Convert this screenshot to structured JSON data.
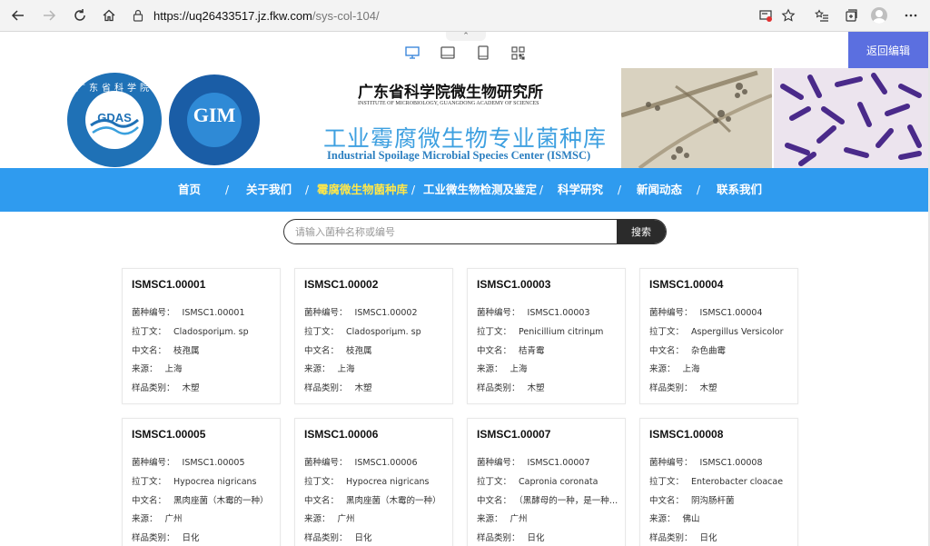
{
  "browser": {
    "url_host": "https://uq26433517.jz.fkw.com",
    "url_path": "/sys-col-104/"
  },
  "editor": {
    "back_edit": "返回编辑",
    "collapse_glyph": "⌃"
  },
  "header": {
    "institute_cn": "广东省科学院微生物研究所",
    "institute_en": "INSTITUTE OF MICROBIOLOGY, GUANGDONG ACADEMY OF SCIENCES",
    "site_cn": "工业霉腐微生物专业菌种库",
    "site_en": "Industrial Spoilage Microbial Species Center (ISMSC)",
    "logo1_text": "GDAS",
    "logo1_ring": "广东省科学院",
    "logo2_text": "GIM"
  },
  "nav": [
    {
      "label": "首页",
      "active": false
    },
    {
      "label": "关于我们",
      "active": false
    },
    {
      "label": "霉腐微生物菌种库",
      "active": true
    },
    {
      "label": "工业微生物检测及鉴定",
      "active": false
    },
    {
      "label": "科学研究",
      "active": false
    },
    {
      "label": "新闻动态",
      "active": false
    },
    {
      "label": "联系我们",
      "active": false
    }
  ],
  "nav_separator": "/",
  "search": {
    "placeholder": "请输入菌种名称或编号",
    "button": "搜索"
  },
  "labels": {
    "code": "菌种编号：",
    "latin": "拉丁文：",
    "cn": "中文名：",
    "source": "来源：",
    "category": "样品类别："
  },
  "strains": [
    {
      "title": "ISMSC1.00001",
      "code": "ISMSC1.00001",
      "latin": "Cladosporiμm. sp",
      "cn": "枝孢属",
      "source": "上海",
      "category": "木塑"
    },
    {
      "title": "ISMSC1.00002",
      "code": "ISMSC1.00002",
      "latin": "Cladosporiμm. sp",
      "cn": "枝孢属",
      "source": "上海",
      "category": "木塑"
    },
    {
      "title": "ISMSC1.00003",
      "code": "ISMSC1.00003",
      "latin": "Penicillium citrinμm",
      "cn": "桔青霉",
      "source": "上海",
      "category": "木塑"
    },
    {
      "title": "ISMSC1.00004",
      "code": "ISMSC1.00004",
      "latin": "Aspergillus Versicolor",
      "cn": "杂色曲霉",
      "source": "上海",
      "category": "木塑"
    },
    {
      "title": "ISMSC1.00005",
      "code": "ISMSC1.00005",
      "latin": "Hypocrea nigricans",
      "cn": "黑肉座菌（木霉的一种）",
      "source": "广州",
      "category": "日化"
    },
    {
      "title": "ISMSC1.00006",
      "code": "ISMSC1.00006",
      "latin": "Hypocrea nigricans",
      "cn": "黑肉座菌（木霉的一种）",
      "source": "广州",
      "category": "日化"
    },
    {
      "title": "ISMSC1.00007",
      "code": "ISMSC1.00007",
      "latin": "Capronia coronata",
      "cn": "（黑酵母的一种，是一种地...",
      "source": "广州",
      "category": "日化"
    },
    {
      "title": "ISMSC1.00008",
      "code": "ISMSC1.00008",
      "latin": "Enterobacter cloacae",
      "cn": "阴沟肠杆菌",
      "source": "佛山",
      "category": "日化"
    }
  ],
  "colors": {
    "nav_bg": "#2f9bef",
    "nav_active": "#ffe74a",
    "edit_button": "#5b6fe0"
  }
}
